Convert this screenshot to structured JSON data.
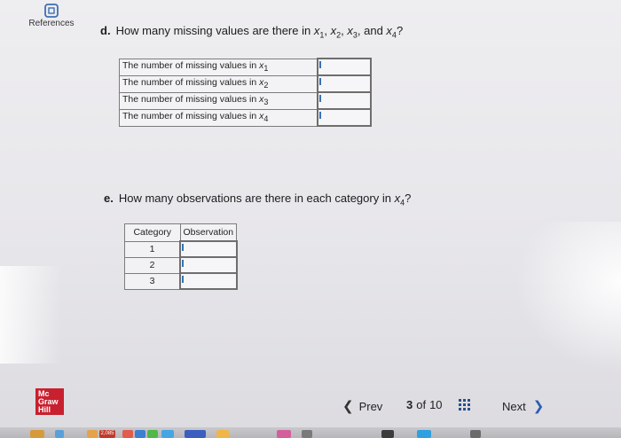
{
  "references": {
    "label": "References"
  },
  "question_d": {
    "number": "d.",
    "prefix": "How many missing values are there in ",
    "vars": [
      "x",
      "x",
      "x",
      "x"
    ],
    "subs": [
      "1",
      "2",
      "3",
      "4"
    ],
    "separator": ",",
    "conjunction": " and ",
    "suffix": "?",
    "rows": [
      {
        "label": "The number of missing values in ",
        "var": "x",
        "sub": "1",
        "value": ""
      },
      {
        "label": "The number of missing values in ",
        "var": "x",
        "sub": "2",
        "value": ""
      },
      {
        "label": "The number of missing values in ",
        "var": "x",
        "sub": "3",
        "value": ""
      },
      {
        "label": "The number of missing values in ",
        "var": "x",
        "sub": "4",
        "value": ""
      }
    ]
  },
  "question_e": {
    "number": "e.",
    "prefix": "How many observations are there in each category in ",
    "var": "x",
    "sub": "4",
    "suffix": "?",
    "headers": [
      "Category",
      "Observation"
    ],
    "rows": [
      {
        "category": "1",
        "value": ""
      },
      {
        "category": "2",
        "value": ""
      },
      {
        "category": "3",
        "value": ""
      }
    ]
  },
  "logo": {
    "lines": [
      "Mc",
      "Graw",
      "Hill"
    ],
    "color": "#c8202f"
  },
  "nav": {
    "prev_label": "Prev",
    "current": "3",
    "of": "of",
    "total": "10",
    "next_label": "Next"
  },
  "dock": {
    "badge": "2,085"
  }
}
